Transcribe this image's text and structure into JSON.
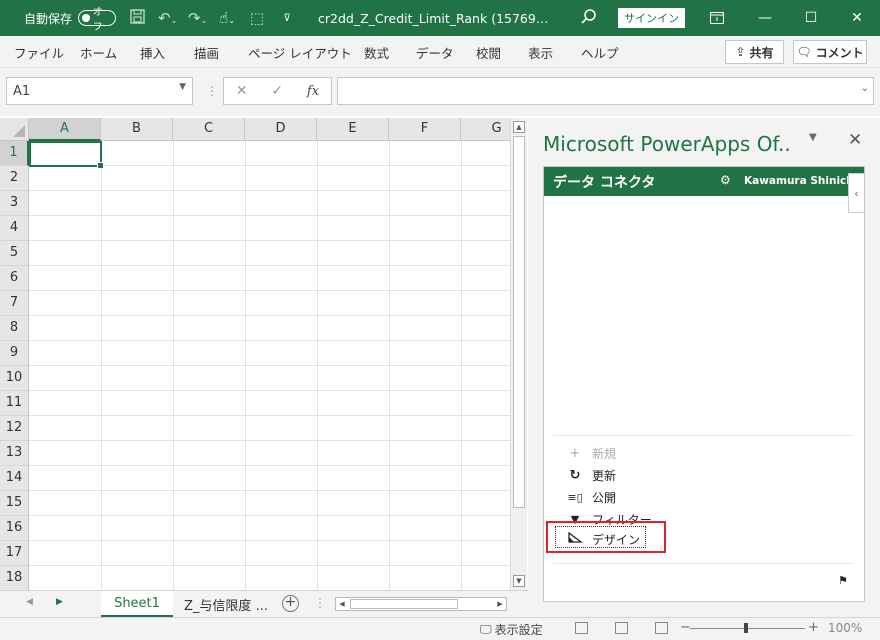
{
  "titlebar": {
    "autosave_label": "自動保存",
    "autosave_state": "オフ",
    "doc_title": "cr2dd_Z_Credit_Limit_Rank (15769…",
    "signin_label": "サインイン"
  },
  "ribbon": {
    "tabs": [
      "ファイル",
      "ホーム",
      "挿入",
      "描画",
      "ページ レイアウト",
      "数式",
      "データ",
      "校閲",
      "表示",
      "ヘルプ"
    ],
    "share_label": "共有",
    "comment_label": "コメント"
  },
  "formula_bar": {
    "name_box": "A1",
    "fx_label": "fx",
    "formula_value": ""
  },
  "grid": {
    "columns": [
      "A",
      "B",
      "C",
      "D",
      "E",
      "F",
      "G"
    ],
    "rows": [
      "1",
      "2",
      "3",
      "4",
      "5",
      "6",
      "7",
      "8",
      "9",
      "10",
      "11",
      "12",
      "13",
      "14",
      "15",
      "16",
      "17",
      "18"
    ],
    "selected_cell": "A1"
  },
  "sheets": {
    "tabs": [
      "Sheet1",
      "Z_与信限度 ..."
    ],
    "active": "Sheet1"
  },
  "taskpane": {
    "title": "Microsoft PowerApps Of..",
    "addin_title": "データ コネクタ",
    "user_name": "Kawamura Shinichi",
    "actions": {
      "new": "新規",
      "refresh": "更新",
      "publish": "公開",
      "filter": "フィルター",
      "design": "デザイン"
    }
  },
  "statusbar": {
    "display_settings": "表示設定",
    "zoom_level": "100%"
  },
  "colors": {
    "excel_green": "#217346",
    "highlight_red": "#e3212a"
  }
}
